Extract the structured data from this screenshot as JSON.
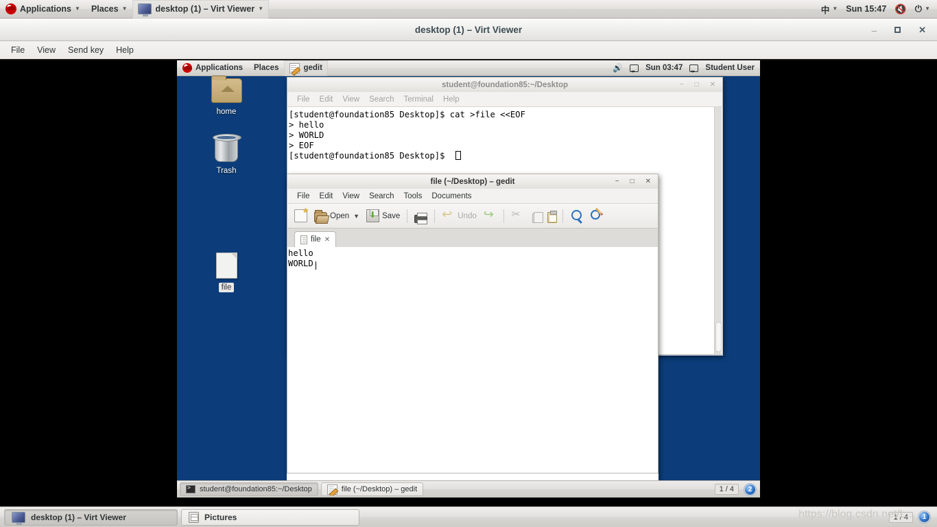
{
  "host": {
    "panel": {
      "applications": "Applications",
      "places": "Places",
      "window_button": "desktop (1) – Virt Viewer",
      "input_method": "中",
      "clock": "Sun 15:47",
      "icons": {
        "logo": "redhat-logo",
        "volume": "volume-muted-icon",
        "power": "power-icon",
        "caret": "▾"
      }
    },
    "taskbar": {
      "items": [
        {
          "label": "desktop (1) – Virt Viewer",
          "icon": "monitor-icon",
          "active": true
        },
        {
          "label": "Pictures",
          "icon": "pictures-icon",
          "active": false
        }
      ],
      "workspace_count": "1 / 4",
      "workspace_badge": "1",
      "watermark": "https://blog.csdn.net/L..."
    }
  },
  "virt_viewer": {
    "title": "desktop (1) – Virt Viewer",
    "menu": [
      "File",
      "View",
      "Send key",
      "Help"
    ],
    "window_buttons": {
      "minimize": "−",
      "maximize": "□",
      "close": "✕"
    }
  },
  "guest": {
    "panel": {
      "applications": "Applications",
      "places": "Places",
      "window_button": "gedit",
      "clock": "Sun 03:47",
      "user": "Student User",
      "icons": {
        "volume": "volume-icon",
        "display": "display-icon",
        "user": "user-icon"
      }
    },
    "desktop_icons": [
      {
        "label": "home",
        "icon": "home-folder-icon",
        "selected": false
      },
      {
        "label": "Trash",
        "icon": "trash-icon",
        "selected": false
      },
      {
        "label": "file",
        "icon": "text-file-icon",
        "selected": true
      }
    ],
    "terminal": {
      "title": "student@foundation85:~/Desktop",
      "menu": [
        "File",
        "Edit",
        "View",
        "Search",
        "Terminal",
        "Help"
      ],
      "lines": "[student@foundation85 Desktop]$ cat >file <<EOF\n> hello\n> WORLD\n> EOF\n[student@foundation85 Desktop]$ ",
      "window_buttons": {
        "minimize": "−",
        "maximize": "□",
        "close": "✕"
      }
    },
    "gedit": {
      "title": "file (~/Desktop) – gedit",
      "menu": [
        "File",
        "Edit",
        "View",
        "Search",
        "Tools",
        "Documents"
      ],
      "toolbar": {
        "new_label": "",
        "open_label": "Open",
        "save_label": "Save",
        "print_label": "",
        "undo_label": "Undo",
        "redo_label": "",
        "items": [
          "new",
          "open",
          "save",
          "print",
          "undo",
          "redo",
          "cut",
          "copy",
          "paste",
          "find",
          "replace"
        ]
      },
      "tab": {
        "label": "file",
        "close": "✕"
      },
      "content": "hello\nWORLD",
      "window_buttons": {
        "minimize": "−",
        "maximize": "□",
        "close": "✕"
      }
    },
    "taskbar": {
      "items": [
        {
          "label": "student@foundation85:~/Desktop",
          "icon": "terminal-icon",
          "active": true
        },
        {
          "label": "file (~/Desktop) – gedit",
          "icon": "gedit-icon",
          "active": false
        }
      ],
      "workspace_count": "1 / 4",
      "workspace_badge": "2"
    }
  }
}
